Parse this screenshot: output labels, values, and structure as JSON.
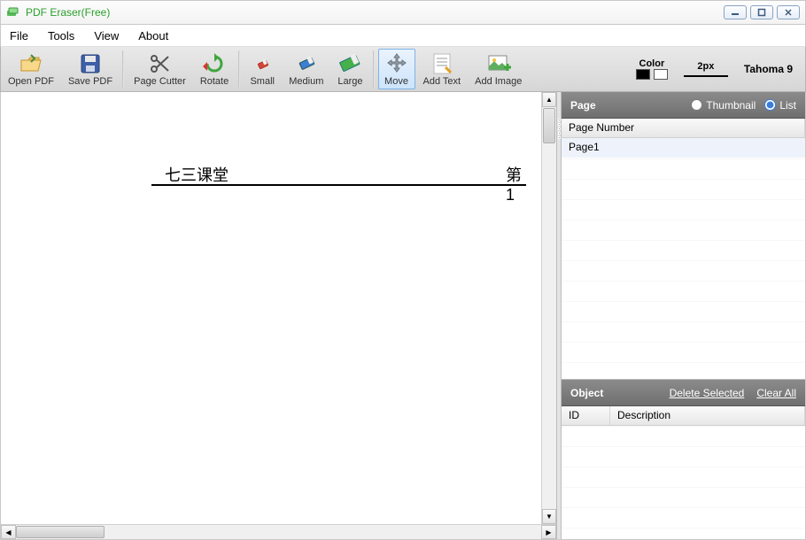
{
  "window": {
    "title": "PDF Eraser(Free)"
  },
  "menu": {
    "file": "File",
    "tools": "Tools",
    "view": "View",
    "about": "About"
  },
  "toolbar": {
    "open": "Open PDF",
    "save": "Save PDF",
    "cutter": "Page Cutter",
    "rotate": "Rotate",
    "small": "Small",
    "medium": "Medium",
    "large": "Large",
    "move": "Move",
    "addtext": "Add Text",
    "addimage": "Add Image",
    "color_label": "Color",
    "width_label": "2px",
    "font_label": "Tahoma 9"
  },
  "doc": {
    "left_text": "七三课堂",
    "right_text": "第 1"
  },
  "pagePanel": {
    "title": "Page",
    "thumbnail": "Thumbnail",
    "list": "List",
    "col_pagenum": "Page Number",
    "rows": {
      "r1": "Page1"
    }
  },
  "objectPanel": {
    "title": "Object",
    "delete": "Delete Selected",
    "clear": "Clear All",
    "col_id": "ID",
    "col_desc": "Description"
  }
}
